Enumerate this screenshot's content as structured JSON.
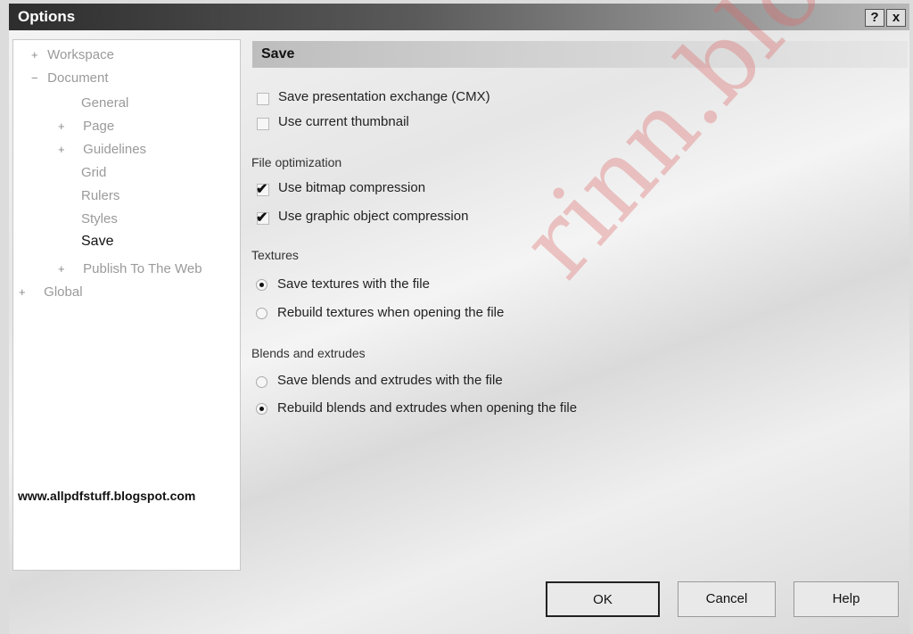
{
  "window": {
    "title": "Options",
    "help_glyph": "?",
    "close_glyph": "x"
  },
  "tree": {
    "items": [
      {
        "label": "Workspace",
        "expander": "+"
      },
      {
        "label": "Document",
        "expander": "−"
      },
      {
        "label": "General",
        "expander": ""
      },
      {
        "label": "Page",
        "expander": "+"
      },
      {
        "label": "Guidelines",
        "expander": "+"
      },
      {
        "label": "Grid",
        "expander": ""
      },
      {
        "label": "Rulers",
        "expander": ""
      },
      {
        "label": "Styles",
        "expander": ""
      },
      {
        "label": "Save",
        "expander": ""
      },
      {
        "label": "Publish To The Web",
        "expander": "+"
      },
      {
        "label": "Global",
        "expander": "+"
      }
    ]
  },
  "watermark_url": "www.allpdfstuff.blogspot.com",
  "panel": {
    "title": "Save",
    "save_pex": "Save presentation exchange (CMX)",
    "use_thumbnail": "Use current thumbnail",
    "file_opt_label": "File optimization",
    "bitmap_compression": "Use bitmap compression",
    "graphic_compression": "Use graphic object compression",
    "textures_label": "Textures",
    "save_textures": "Save textures with the file",
    "rebuild_textures": "Rebuild textures when opening the file",
    "blends_label": "Blends and extrudes",
    "save_blends": "Save blends and extrudes with the file",
    "rebuild_blends": "Rebuild blends and extrudes when opening the file"
  },
  "buttons": {
    "ok": "OK",
    "cancel": "Cancel",
    "help": "Help"
  },
  "blog_watermark": "rinn.blogsp"
}
